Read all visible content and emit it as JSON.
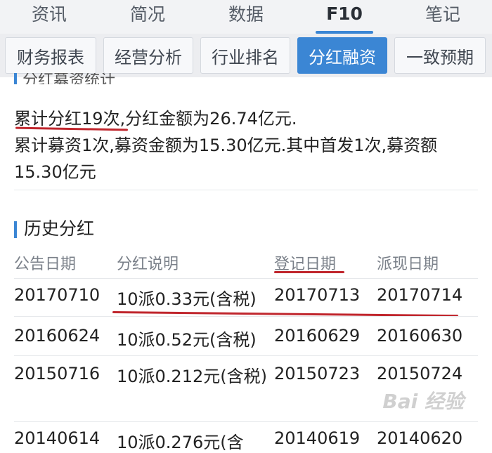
{
  "top_tabs": [
    {
      "label": "资讯",
      "active": false
    },
    {
      "label": "简况",
      "active": false
    },
    {
      "label": "数据",
      "active": false
    },
    {
      "label": "F10",
      "active": true
    },
    {
      "label": "笔记",
      "active": false
    }
  ],
  "sub_tabs": [
    {
      "label": "财务报表",
      "active": false
    },
    {
      "label": "经营分析",
      "active": false
    },
    {
      "label": "行业排名",
      "active": false
    },
    {
      "label": "分红融资",
      "active": true
    },
    {
      "label": "一致预期",
      "active": false
    }
  ],
  "summary_section": {
    "title": "分红募资统计",
    "line1_highlight": "累计分红19次",
    "line1_rest": ",分红金额为26.74亿元.",
    "line2": "累计募资1次,募资金额为15.30亿元.其中首发1次,募资额15.30亿元"
  },
  "history_section": {
    "title": "历史分红",
    "columns": [
      "公告日期",
      "分红说明",
      "登记日期",
      "派现日期"
    ],
    "rows": [
      [
        "20170710",
        "10派0.33元(含税)",
        "20170713",
        "20170714"
      ],
      [
        "20160624",
        "10派0.52元(含税)",
        "20160629",
        "20160630"
      ],
      [
        "20150716",
        "10派0.212元(含税)",
        "20150723",
        "20150724"
      ],
      [
        "20140614",
        "10派0.276元(含",
        "20140619",
        "20140620"
      ]
    ]
  },
  "watermark": "Bai 经验",
  "colors": {
    "accent": "#3b86d4",
    "annotation_red": "#c0262d"
  }
}
